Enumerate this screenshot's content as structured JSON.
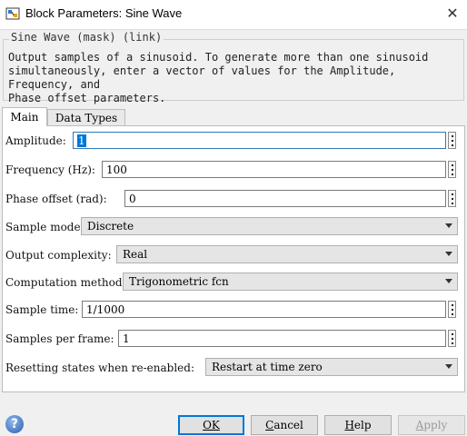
{
  "window": {
    "title": "Block Parameters: Sine Wave",
    "close_glyph": "✕"
  },
  "group": {
    "label": "Sine Wave (mask) (link)",
    "description": "Output samples of a sinusoid.  To generate more than one sinusoid\nsimultaneously, enter a vector of values for the Amplitude, Frequency, and\nPhase offset parameters."
  },
  "tabs": [
    {
      "label": "Main",
      "active": true
    },
    {
      "label": "Data Types",
      "active": false
    }
  ],
  "params": {
    "amplitude": {
      "label": "Amplitude:",
      "value": "1"
    },
    "frequency": {
      "label": "Frequency (Hz):",
      "value": "100"
    },
    "phase": {
      "label": "Phase offset (rad):",
      "value": "0"
    },
    "sample_mode": {
      "label": "Sample mode:",
      "value": "Discrete"
    },
    "output_complexity": {
      "label": "Output complexity:",
      "value": "Real"
    },
    "computation_method": {
      "label": "Computation method:",
      "value": "Trigonometric fcn"
    },
    "sample_time": {
      "label": "Sample time:",
      "value": "1/1000"
    },
    "samples_per_frame": {
      "label": "Samples per frame:",
      "value": "1"
    },
    "resetting": {
      "label": "Resetting states when re-enabled:",
      "value": "Restart at time zero"
    }
  },
  "buttons": {
    "help_icon": "?",
    "ok_label": "OK",
    "cancel_first": "C",
    "cancel_rest": "ancel",
    "help_first": "H",
    "help_rest": "elp",
    "apply_first": "A",
    "apply_rest": "pply"
  },
  "colors": {
    "accent": "#0078d7",
    "panel": "#ffffff",
    "window_bg": "#f0f0f0"
  },
  "icons": [
    "simulink-block-icon",
    "close-icon",
    "vertical-ellipsis-icon",
    "chevron-down-icon",
    "help-icon"
  ]
}
